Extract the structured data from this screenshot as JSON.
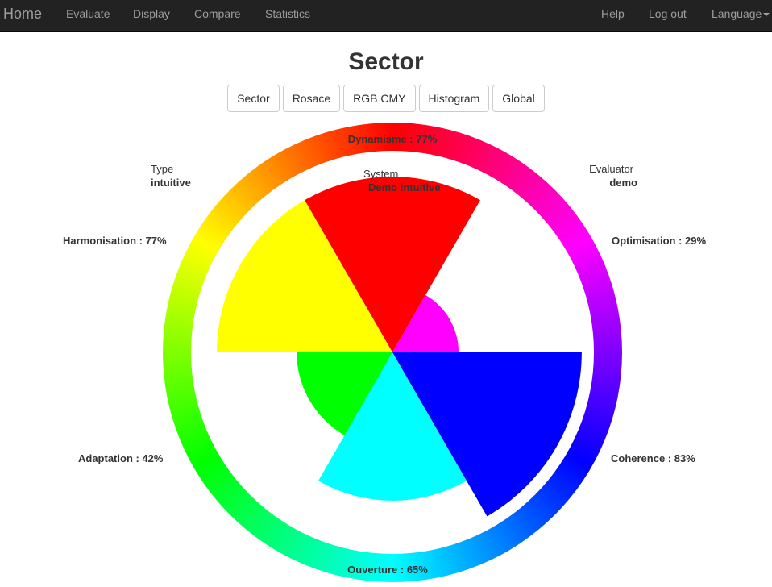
{
  "nav": {
    "brand": "Home",
    "items": [
      "Evaluate",
      "Display",
      "Compare",
      "Statistics"
    ],
    "right_items": [
      "Help",
      "Log out"
    ],
    "language": "Language"
  },
  "page": {
    "title": "Sector"
  },
  "view_buttons": [
    "Sector",
    "Rosace",
    "RGB CMY",
    "Histogram",
    "Global"
  ],
  "info": {
    "type_label": "Type",
    "type_value": "intuitive",
    "system_label": "System",
    "system_value": "Demo intuitive",
    "evaluator_label": "Evaluator",
    "evaluator_value": "demo"
  },
  "chart_data": {
    "type": "pie",
    "categories": [
      "Dynamisme",
      "Optimisation",
      "Coherence",
      "Ouverture",
      "Adaptation",
      "Harmonisation"
    ],
    "values": [
      77,
      29,
      83,
      65,
      42,
      77
    ],
    "labels": [
      "Dynamisme : 77%",
      "Optimisation : 29%",
      "Coherence : 83%",
      "Ouverture : 65%",
      "Adaptation : 42%",
      "Harmonisation : 77%"
    ],
    "colors": [
      "#ff0000",
      "#ff00ff",
      "#0000ff",
      "#00ffff",
      "#00ff00",
      "#ffff00"
    ],
    "max": 100
  }
}
